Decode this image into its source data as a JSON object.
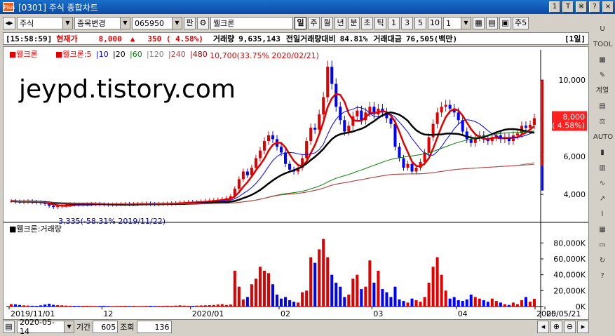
{
  "window": {
    "logo": "Plus",
    "title": "[0301] 주식 종합차트",
    "buttons": [
      "1",
      "T",
      "※",
      "?",
      "×"
    ]
  },
  "toolbar": {
    "market": "주식",
    "code_change": "종목변경",
    "code": "065950",
    "pan": "판",
    "stock_name": "웰크론",
    "periods": [
      "일",
      "주",
      "월",
      "년",
      "분",
      "초",
      "틱"
    ],
    "active_period": "일",
    "nums": [
      "1",
      "3",
      "5",
      "10"
    ],
    "interval": "1",
    "right_label": "주5"
  },
  "info": {
    "time": "[15:58:59]",
    "price_label": "현재가",
    "price": "8,000",
    "arrow": "▲",
    "change": "350 ( 4.58%)",
    "volume_label": "거래량",
    "volume": "9,635,143",
    "prev_label": "전일거래량대비",
    "prev_ratio": "84.81%",
    "amount_label": "거래대금",
    "amount": "76,505(백만)",
    "period_tag": "[1일]"
  },
  "watermark": "jeypd.tistory.com",
  "chart_data": {
    "type": "candlestick",
    "stock": "웰크론",
    "legend": {
      "name": "웰크론",
      "ma_label": "웰크론:5",
      "periods": [
        "10",
        "20",
        "60",
        "120",
        "240",
        "480"
      ],
      "ma_colors": [
        "#e00000",
        "#0000ff",
        "#000000",
        "#008000",
        "#808080",
        "#c04040",
        "#a00000"
      ]
    },
    "y_ticks": [
      "10,000",
      "8,000",
      "6,000",
      "4,000"
    ],
    "y_tick_values": [
      10000,
      8000,
      6000,
      4000
    ],
    "ylim": [
      2900,
      11000
    ],
    "last_price": "8,000",
    "last_pct": "( 4.58%)",
    "high_label": "10,700(33.75% 2020/02/21)",
    "low_label": "3,335(-58.31% 2019/11/22)",
    "x_labels": [
      "2019/11/01",
      "12",
      "2020/01",
      "02",
      "03",
      "04",
      "05",
      "2020/05/21"
    ],
    "closes": [
      3650,
      3620,
      3600,
      3620,
      3640,
      3600,
      3580,
      3560,
      3500,
      3400,
      3335,
      3380,
      3420,
      3450,
      3480,
      3470,
      3460,
      3470,
      3480,
      3490,
      3500,
      3480,
      3470,
      3460,
      3470,
      3480,
      3490,
      3500,
      3480,
      3490,
      3500,
      3510,
      3520,
      3500,
      3490,
      3500,
      3510,
      3520,
      3530,
      3540,
      3560,
      3580,
      3600,
      3580,
      3600,
      3620,
      3650,
      3680,
      3700,
      3720,
      3750,
      3800,
      3900,
      4300,
      4800,
      5200,
      5000,
      5400,
      5900,
      6300,
      6800,
      7100,
      6900,
      6500,
      6200,
      5600,
      5300,
      5200,
      5400,
      5900,
      6800,
      7500,
      7400,
      8200,
      9100,
      10700,
      9800,
      8600,
      7900,
      7300,
      7600,
      8100,
      8400,
      7900,
      8300,
      8600,
      8200,
      8500,
      8300,
      8000,
      7700,
      6500,
      5900,
      5400,
      5600,
      5200,
      5400,
      5700,
      6200,
      7000,
      7700,
      8300,
      8600,
      8700,
      8500,
      8300,
      7900,
      7300,
      6900,
      6700,
      7000,
      7100,
      6900,
      6800,
      7000,
      7100,
      6900,
      7000,
      6800,
      7100,
      7200,
      7600,
      7500,
      7650,
      8000
    ],
    "volume_ticks": [
      "80,000K",
      "60,000K",
      "40,000K",
      "20,000K",
      "0K"
    ],
    "volume_tick_values": [
      80000,
      60000,
      40000,
      20000,
      0
    ],
    "volume_legend": "웰크론:거래량",
    "volumes": [
      3000,
      2800,
      2000,
      1500,
      1200,
      1000,
      900,
      1500,
      2500,
      3500,
      2200,
      1800,
      1500,
      1200,
      1000,
      900,
      800,
      900,
      1000,
      800,
      700,
      800,
      900,
      700,
      600,
      700,
      800,
      900,
      700,
      800,
      600,
      700,
      800,
      900,
      700,
      800,
      900,
      1000,
      900,
      1200,
      1500,
      1200,
      1000,
      900,
      1200,
      1400,
      1600,
      1800,
      2000,
      2500,
      3000,
      2000,
      2500,
      45000,
      25000,
      9000,
      12000,
      28000,
      35000,
      50000,
      45000,
      42000,
      28000,
      15000,
      10000,
      12000,
      8000,
      6000,
      5000,
      18000,
      20000,
      62000,
      55000,
      72000,
      85000,
      62000,
      40000,
      30000,
      25000,
      12000,
      15000,
      35000,
      40000,
      22000,
      25000,
      58000,
      30000,
      45000,
      22000,
      18000,
      12000,
      25000,
      9000,
      7000,
      5000,
      10000,
      8000,
      6000,
      12000,
      30000,
      50000,
      62000,
      40000,
      20000,
      10000,
      12000,
      8000,
      7000,
      9000,
      15000,
      12000,
      10000,
      8000,
      6000,
      10000,
      7000,
      5000,
      3000,
      2000,
      5000,
      3000,
      8000,
      12000,
      6000,
      9635
    ]
  },
  "bottom": {
    "date": "2020-05-14",
    "period_label": "기간",
    "period": "605",
    "query_label": "조회",
    "count": "136"
  },
  "sidebar_icons": [
    "chart-up-icon",
    "tool-icon",
    "line-icon",
    "wrench-icon",
    "gyeyl-icon",
    "doc-icon",
    "scale-icon",
    "auto-icon",
    "candle-icon",
    "bar-icon",
    "wave-icon",
    "trend-icon",
    "pattern-icon",
    "grid-icon",
    "window-icon",
    "refresh-icon",
    "help-icon"
  ],
  "sidebar_labels": [
    "U",
    "TOOL",
    "",
    "",
    "계열",
    "",
    "",
    "AUTO",
    "",
    "",
    "",
    "",
    "",
    "",
    "",
    "",
    ""
  ]
}
